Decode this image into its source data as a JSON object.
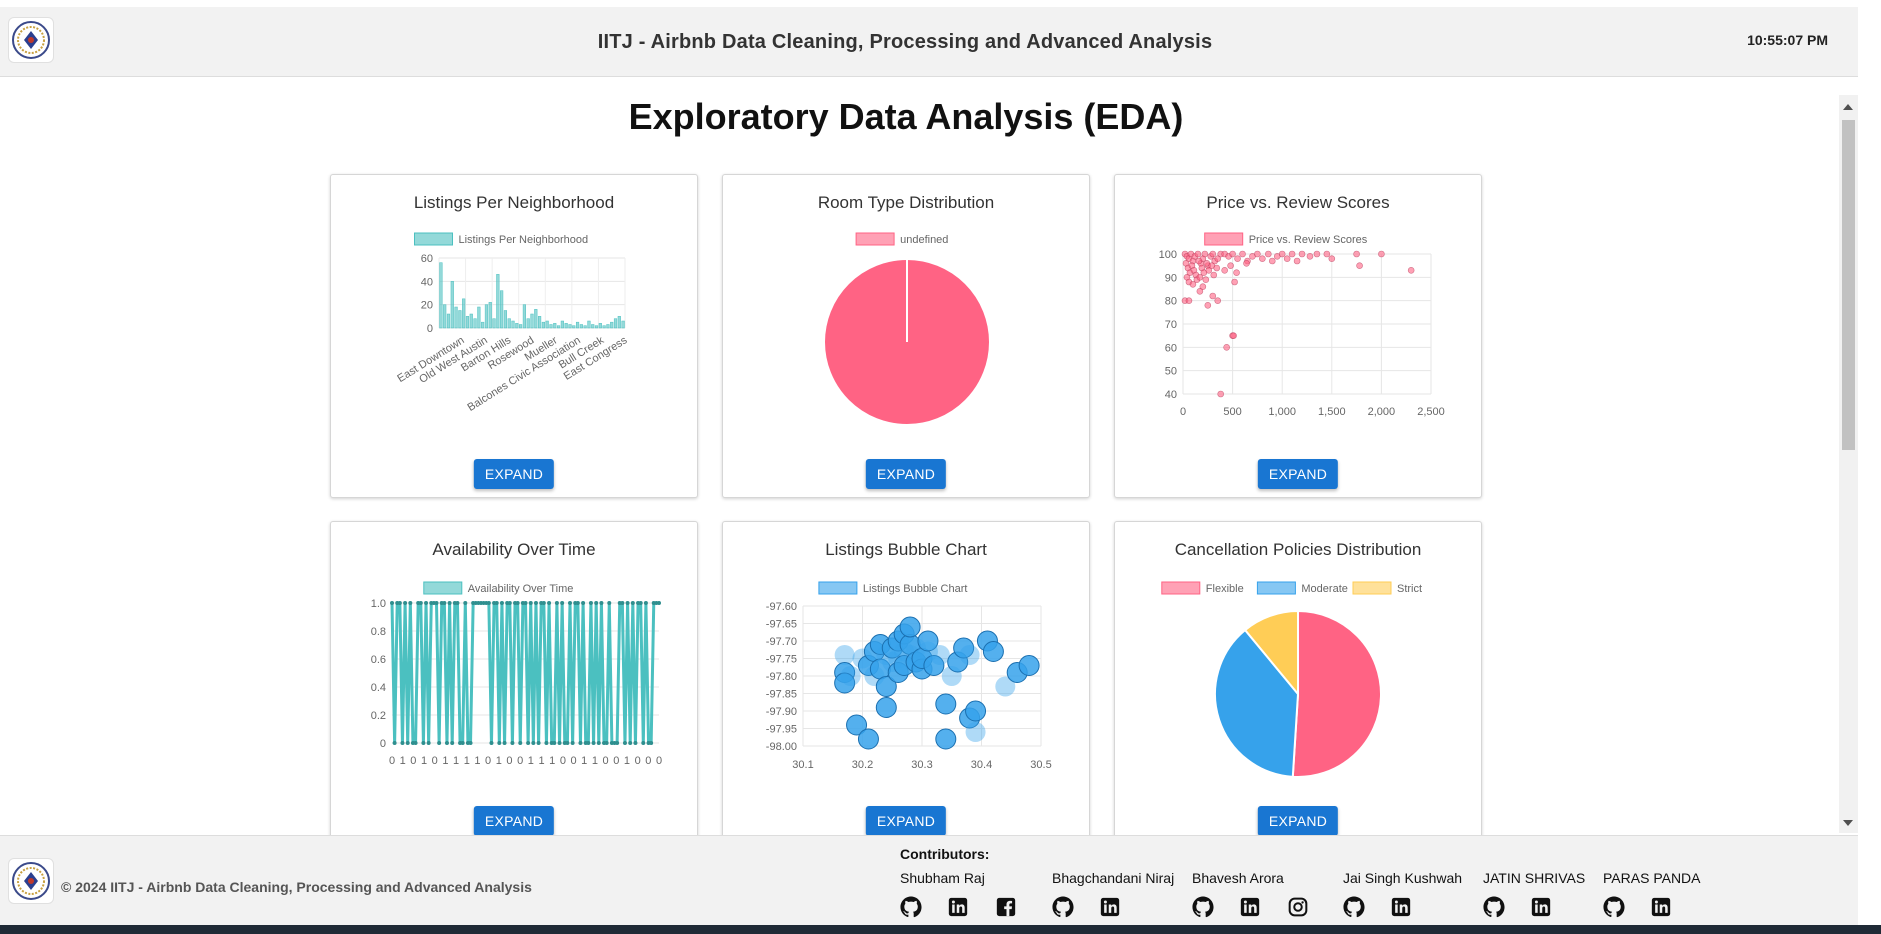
{
  "header": {
    "title": "IITJ - Airbnb Data Cleaning, Processing and Advanced Analysis",
    "time": "10:55:07 PM",
    "logo_icon": "iitj-emblem-icon"
  },
  "page": {
    "title": "Exploratory Data Analysis (EDA)"
  },
  "expand_label": "EXPAND",
  "charts": {
    "c1": {
      "title": "Listings Per Neighborhood"
    },
    "c2": {
      "title": "Room Type Distribution"
    },
    "c3": {
      "title": "Price vs. Review Scores"
    },
    "c4": {
      "title": "Availability Over Time"
    },
    "c5": {
      "title": "Listings Bubble Chart"
    },
    "c6": {
      "title": "Cancellation Policies Distribution"
    }
  },
  "chart_data": [
    {
      "type": "bar",
      "title": "Listings Per Neighborhood",
      "legend": [
        "Listings Per Neighborhood"
      ],
      "color": "#4bc0c0",
      "ylim": [
        0,
        60
      ],
      "yticks": [
        0,
        20,
        40,
        60
      ],
      "xtick_labels": [
        "East Downtown",
        "Old West Austin",
        "Barton Hills",
        "Rosewood",
        "Mueller",
        "Balcones Civic Association",
        "Bull Creek",
        "East Congress"
      ],
      "values": [
        56,
        20,
        12,
        40,
        18,
        15,
        25,
        10,
        12,
        8,
        18,
        5,
        20,
        22,
        8,
        46,
        32,
        15,
        8,
        6,
        4,
        3,
        20,
        8,
        12,
        16,
        10,
        5,
        6,
        3,
        4,
        2,
        6,
        4,
        3,
        2,
        5,
        3,
        2,
        6,
        3,
        2,
        4,
        2,
        3,
        5,
        8,
        10,
        6
      ]
    },
    {
      "type": "pie",
      "title": "Room Type Distribution",
      "legend": [
        "undefined"
      ],
      "slices": [
        {
          "label": "",
          "value": 100,
          "color": "#ff6384"
        }
      ]
    },
    {
      "type": "scatter",
      "title": "Price vs. Review Scores",
      "legend": [
        "Price vs. Review Scores"
      ],
      "color": "#ff6384",
      "xlim": [
        0,
        2500
      ],
      "ylim": [
        40,
        100
      ],
      "xticks": [
        "0",
        "500",
        "1,000",
        "1,500",
        "2,000",
        "2,500"
      ],
      "yticks": [
        40,
        50,
        60,
        70,
        80,
        90,
        100
      ],
      "points": [
        [
          20,
          100
        ],
        [
          40,
          99
        ],
        [
          60,
          98
        ],
        [
          80,
          100
        ],
        [
          100,
          97
        ],
        [
          120,
          99
        ],
        [
          150,
          100
        ],
        [
          180,
          96
        ],
        [
          200,
          98
        ],
        [
          220,
          100
        ],
        [
          250,
          95
        ],
        [
          280,
          99
        ],
        [
          300,
          100
        ],
        [
          320,
          97
        ],
        [
          350,
          98
        ],
        [
          380,
          100
        ],
        [
          30,
          96
        ],
        [
          50,
          94
        ],
        [
          70,
          92
        ],
        [
          90,
          95
        ],
        [
          110,
          93
        ],
        [
          130,
          91
        ],
        [
          160,
          97
        ],
        [
          190,
          94
        ],
        [
          210,
          92
        ],
        [
          240,
          96
        ],
        [
          260,
          93
        ],
        [
          290,
          95
        ],
        [
          310,
          91
        ],
        [
          340,
          94
        ],
        [
          40,
          90
        ],
        [
          60,
          88
        ],
        [
          100,
          87
        ],
        [
          140,
          89
        ],
        [
          170,
          90
        ],
        [
          200,
          86
        ],
        [
          230,
          89
        ],
        [
          20,
          80
        ],
        [
          60,
          80
        ],
        [
          170,
          84
        ],
        [
          250,
          78
        ],
        [
          300,
          82
        ],
        [
          350,
          80
        ],
        [
          420,
          100
        ],
        [
          460,
          99
        ],
        [
          500,
          100
        ],
        [
          550,
          98
        ],
        [
          600,
          100
        ],
        [
          650,
          97
        ],
        [
          700,
          99
        ],
        [
          750,
          100
        ],
        [
          800,
          98
        ],
        [
          860,
          100
        ],
        [
          900,
          97
        ],
        [
          950,
          99
        ],
        [
          1000,
          100
        ],
        [
          1050,
          98
        ],
        [
          1100,
          100
        ],
        [
          1150,
          97
        ],
        [
          1200,
          100
        ],
        [
          1280,
          99
        ],
        [
          1350,
          100
        ],
        [
          1450,
          100
        ],
        [
          1500,
          98
        ],
        [
          1750,
          100
        ],
        [
          1780,
          95
        ],
        [
          2000,
          100
        ],
        [
          2300,
          93
        ],
        [
          420,
          93
        ],
        [
          480,
          95
        ],
        [
          540,
          92
        ],
        [
          640,
          96
        ],
        [
          520,
          88
        ],
        [
          440,
          60
        ],
        [
          500,
          65
        ],
        [
          510,
          65
        ],
        [
          380,
          40
        ]
      ]
    },
    {
      "type": "line",
      "title": "Availability Over Time",
      "legend": [
        "Availability Over Time"
      ],
      "color": "#4bc0c0",
      "ylim": [
        0,
        1
      ],
      "yticks": [
        "0",
        "0.2",
        "0.4",
        "0.6",
        "0.8",
        "1.0"
      ],
      "xtick_labels": [
        "0",
        "1",
        "0",
        "1",
        "0",
        "1",
        "1",
        "1",
        "1",
        "0",
        "1",
        "0",
        "0",
        "1",
        "1",
        "1",
        "0",
        "0",
        "1",
        "1",
        "0",
        "0",
        "1",
        "0",
        "0",
        "0"
      ],
      "values": [
        1,
        0,
        1,
        1,
        0,
        1,
        0,
        1,
        0,
        0,
        1,
        1,
        0,
        1,
        0,
        1,
        1,
        1,
        0,
        1,
        1,
        0,
        1,
        0,
        1,
        1,
        0,
        0,
        1,
        0,
        0,
        1,
        1,
        1,
        1,
        1,
        1,
        1,
        0,
        1,
        1,
        0,
        1,
        0,
        1,
        1,
        0,
        1,
        1,
        0,
        1,
        1,
        0,
        1,
        0,
        1,
        0,
        1,
        1,
        0,
        1,
        0,
        0,
        1,
        0,
        1,
        0,
        0,
        1,
        0,
        1,
        1,
        0,
        1,
        0,
        0,
        1,
        0,
        1,
        0,
        1,
        0,
        0,
        1,
        0,
        0,
        0,
        1,
        1,
        0,
        1,
        0,
        1,
        0,
        1,
        1,
        0,
        1,
        0,
        0,
        1,
        1,
        1
      ]
    },
    {
      "type": "scatter",
      "title": "Listings Bubble Chart",
      "legend": [
        "Listings Bubble Chart"
      ],
      "color": "#36a2eb",
      "xlim": [
        30.1,
        30.5
      ],
      "ylim": [
        -98.0,
        -97.6
      ],
      "xticks": [
        "30.1",
        "30.2",
        "30.3",
        "30.4",
        "30.5"
      ],
      "yticks": [
        "-97.60",
        "-97.65",
        "-97.70",
        "-97.75",
        "-97.80",
        "-97.85",
        "-97.90",
        "-97.95",
        "-98.00"
      ],
      "points": [
        [
          30.17,
          -97.74
        ],
        [
          30.17,
          -97.79
        ],
        [
          30.17,
          -97.82
        ],
        [
          30.18,
          -97.8
        ],
        [
          30.19,
          -97.94
        ],
        [
          30.21,
          -97.98
        ],
        [
          30.2,
          -97.75
        ],
        [
          30.21,
          -97.77
        ],
        [
          30.22,
          -97.73
        ],
        [
          30.22,
          -97.8
        ],
        [
          30.23,
          -97.71
        ],
        [
          30.23,
          -97.78
        ],
        [
          30.24,
          -97.74
        ],
        [
          30.24,
          -97.83
        ],
        [
          30.24,
          -97.89
        ],
        [
          30.25,
          -97.76
        ],
        [
          30.25,
          -97.72
        ],
        [
          30.26,
          -97.7
        ],
        [
          30.26,
          -97.75
        ],
        [
          30.26,
          -97.79
        ],
        [
          30.27,
          -97.68
        ],
        [
          30.27,
          -97.73
        ],
        [
          30.27,
          -97.77
        ],
        [
          30.28,
          -97.71
        ],
        [
          30.28,
          -97.74
        ],
        [
          30.28,
          -97.66
        ],
        [
          30.29,
          -97.76
        ],
        [
          30.29,
          -97.72
        ],
        [
          30.3,
          -97.78
        ],
        [
          30.3,
          -97.75
        ],
        [
          30.31,
          -97.73
        ],
        [
          30.31,
          -97.7
        ],
        [
          30.32,
          -97.77
        ],
        [
          30.33,
          -97.74
        ],
        [
          30.34,
          -97.88
        ],
        [
          30.34,
          -97.98
        ],
        [
          30.35,
          -97.8
        ],
        [
          30.36,
          -97.76
        ],
        [
          30.37,
          -97.72
        ],
        [
          30.38,
          -97.74
        ],
        [
          30.38,
          -97.92
        ],
        [
          30.39,
          -97.9
        ],
        [
          30.39,
          -97.96
        ],
        [
          30.41,
          -97.7
        ],
        [
          30.42,
          -97.73
        ],
        [
          30.44,
          -97.83
        ],
        [
          30.46,
          -97.79
        ],
        [
          30.48,
          -97.77
        ]
      ]
    },
    {
      "type": "pie",
      "title": "Cancellation Policies Distribution",
      "legend": [
        "Flexible",
        "Moderate",
        "Strict"
      ],
      "slices": [
        {
          "label": "Flexible",
          "value": 51,
          "color": "#ff6384"
        },
        {
          "label": "Moderate",
          "value": 38,
          "color": "#36a2eb"
        },
        {
          "label": "Strict",
          "value": 11,
          "color": "#ffcd56"
        }
      ]
    }
  ],
  "footer": {
    "copyright": "© 2024 IITJ - Airbnb Data Cleaning, Processing and Advanced Analysis",
    "contributors_title": "Contributors:",
    "contributors": [
      {
        "name": "Shubham Raj",
        "icons": [
          "github-icon",
          "linkedin-icon",
          "facebook-icon"
        ]
      },
      {
        "name": "Bhagchandani Niraj",
        "icons": [
          "github-icon",
          "linkedin-icon"
        ]
      },
      {
        "name": "Bhavesh Arora",
        "icons": [
          "github-icon",
          "linkedin-icon",
          "instagram-icon"
        ]
      },
      {
        "name": "Jai Singh Kushwah",
        "icons": [
          "github-icon",
          "linkedin-icon"
        ]
      },
      {
        "name": "JATIN SHRIVAS",
        "icons": [
          "github-icon",
          "linkedin-icon"
        ]
      },
      {
        "name": "PARAS PANDA",
        "icons": [
          "github-icon",
          "linkedin-icon"
        ]
      }
    ]
  }
}
